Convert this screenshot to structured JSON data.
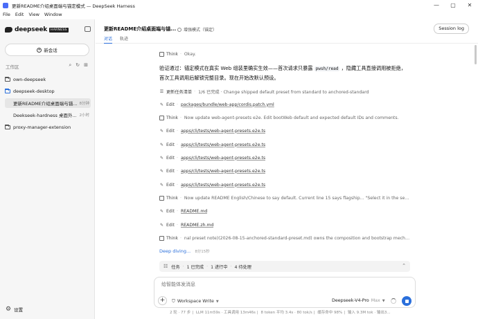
{
  "window": {
    "title": "更新README介绍桌面端与锚定模式 — DeepSeek Harness",
    "controls": [
      "—",
      "▢",
      "✕"
    ]
  },
  "menu": [
    "File",
    "Edit",
    "View",
    "Window"
  ],
  "sidebar": {
    "logo_text": "deepseek",
    "badge": "HARNESS",
    "new_session_label": "新会话",
    "workspace_label": "工作区",
    "projects": [
      {
        "name": "own-deepseek"
      },
      {
        "name": "deepseek-desktop"
      }
    ],
    "sessions": [
      {
        "title": "更新README介绍桌面端与锚...",
        "time": "8分钟"
      },
      {
        "title": "Deekseek-hardness 桌面外...",
        "time": "2小时"
      }
    ],
    "extra_project": {
      "name": "proxy-manager-extension"
    },
    "settings_label": "设置"
  },
  "header": {
    "session_title": "更新README介绍桌面端与锚...",
    "mode_label": "增强模式（锚定）",
    "tabs": [
      "对话",
      "轨迹"
    ],
    "session_log_label": "Session log"
  },
  "transcript": {
    "row0": {
      "icon": "think-icon",
      "kind": "Think",
      "detail": "Okay."
    },
    "verify_prefix": "验证通过：锚定模式在真实 Web 组装里确实生效——首次请求只暴露",
    "verify_code": "pwsh/read",
    "verify_suffix": "，隐藏工具直接调用被拒绝，首次工具调用后解锁完整目录。现在开始改默认预设。",
    "row1": {
      "kind": "更新任务清单",
      "detail": "1/6 已完成 · Change shipped default preset from standard to anchored-standard"
    },
    "row2": {
      "kind": "Edit",
      "detail": "packages/bundle/web-app/cordis.patch.yml"
    },
    "row3": {
      "kind": "Think",
      "detail": "Now update web-agent-presets e2e. Edit bootWeb default and expected default IDs and comments."
    },
    "row4": {
      "kind": "Edit",
      "detail": "apps/cli/tests/web-agent-presets.e2e.ts"
    },
    "row5": {
      "kind": "Edit",
      "detail": "apps/cli/tests/web-agent-presets.e2e.ts"
    },
    "row6": {
      "kind": "Edit",
      "detail": "apps/cli/tests/web-agent-presets.e2e.ts"
    },
    "row7": {
      "kind": "Edit",
      "detail": "apps/cli/tests/web-agent-presets.e2e.ts"
    },
    "row8": {
      "kind": "Edit",
      "detail": "apps/cli/tests/web-agent-presets.e2e.ts"
    },
    "row9": {
      "kind": "Think",
      "detail": "Now update README English/Chinese to say default. Current line 15 says flagship... \"Select it in the session ..."
    },
    "row10": {
      "kind": "Edit",
      "detail": "README.md"
    },
    "row11": {
      "kind": "Edit",
      "detail": "README.zh.md"
    },
    "row12": {
      "kind": "Think",
      "detail": "nal preset note)(2026-08-15-anchored-standard-preset.md) owns the composition and bootstrap mechanism"
    },
    "deep_diving": "Deep diving...",
    "deep_time": "8分15秒"
  },
  "tasks": {
    "label": "任务",
    "done": "1 已完成",
    "running": "1 进行中",
    "pending": "4 待处理"
  },
  "composer": {
    "placeholder": "给智能体发消息",
    "permission": "Workspace Write",
    "model": "Deepseek-V4-Pro",
    "model_suffix": "Max"
  },
  "status": [
    "2 轮 · 77 步",
    "LLM 11m59s · 工具调用 13m46s",
    "8 token 平均 3.4s · 80 tok/s",
    "缓存命中 98%",
    "输入 9.3M tok · 输出3..."
  ]
}
